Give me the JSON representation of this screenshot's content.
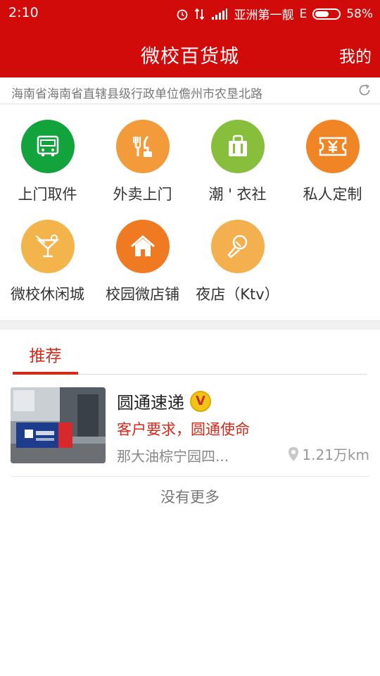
{
  "status_bar": {
    "time": "2:10",
    "carrier": "亚洲第一靓",
    "network": "E",
    "battery": "58%",
    "battery_level": 0.58,
    "icons": [
      "alarm-icon",
      "data-transfer-icon",
      "signal-icon",
      "battery-icon"
    ]
  },
  "nav": {
    "title": "微校百货城",
    "mine": "我的"
  },
  "location": {
    "text": "海南省海南省直辖县级行政单位儋州市农垦北路",
    "icon": "refresh-icon"
  },
  "categories": [
    {
      "label": "上门取件",
      "color": "#12a33d",
      "icon": "delivery-van-icon"
    },
    {
      "label": "外卖上门",
      "color": "#f39a3b",
      "icon": "food-utensils-icon"
    },
    {
      "label": "潮 ' 衣社",
      "color": "#87bf3d",
      "icon": "shopping-bag-icon"
    },
    {
      "label": "私人定制",
      "color": "#f08526",
      "icon": "yuan-ticket-icon"
    },
    {
      "label": "微校休闲城",
      "color": "#f4b44c",
      "icon": "cocktail-icon"
    },
    {
      "label": "校园微店铺",
      "color": "#ef7a22",
      "icon": "home-icon"
    },
    {
      "label": "夜店（Ktv）",
      "color": "#f4b04e",
      "icon": "microphone-icon"
    }
  ],
  "tabs": {
    "active": "推荐"
  },
  "store": {
    "name": "圆通速递",
    "badge": "V",
    "slogan": "客户要求，圆通使命",
    "address": "那大油棕宁园四...",
    "distance": "1.21万km",
    "thumb_banner_text": "圆通速递"
  },
  "footer": {
    "no_more": "没有更多"
  },
  "colors": {
    "brand_red": "#d10a0a",
    "accent_red": "#d32a1a"
  }
}
